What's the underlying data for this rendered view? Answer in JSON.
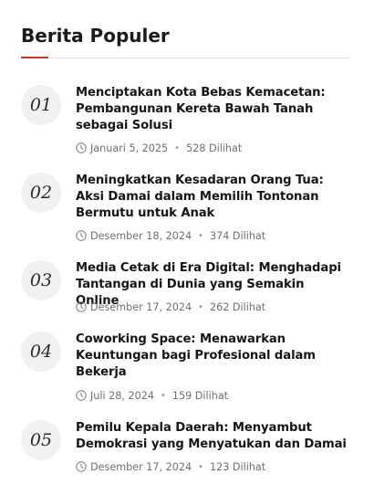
{
  "widget": {
    "title": "Berita Populer",
    "accent_color": "#c0392b",
    "posts": [
      {
        "number": "01",
        "title": "Menciptakan Kota Bebas Kemacetan: Pembangunan Kereta Bawah Tanah sebagai Solusi",
        "date": "Januari 5, 2025",
        "views": "528 Dilihat",
        "icon": "clock-icon"
      },
      {
        "number": "02",
        "title": "Meningkatkan Kesadaran Orang Tua: Aksi Damai dalam Memilih Tontonan Bermutu untuk Anak",
        "date": "Desember 18, 2024",
        "views": "374 Dilihat",
        "icon": "clock-icon"
      },
      {
        "number": "03",
        "title": "Media Cetak di Era Digital: Menghadapi Tantangan di Dunia yang Semakin Online",
        "date": "Desember 17, 2024",
        "views": "262 Dilihat",
        "icon": "clock-icon"
      },
      {
        "number": "04",
        "title": "Coworking Space: Menawarkan Keuntungan bagi Profesional dalam Bekerja",
        "date": "Juli 28, 2024",
        "views": "159 Dilihat",
        "icon": "clock-icon"
      },
      {
        "number": "05",
        "title": "Pemilu Kepala Daerah: Menyambut Demokrasi yang Menyatukan dan Damai",
        "date": "Desember 17, 2024",
        "views": "123 Dilihat",
        "icon": "clock-icon"
      }
    ]
  }
}
